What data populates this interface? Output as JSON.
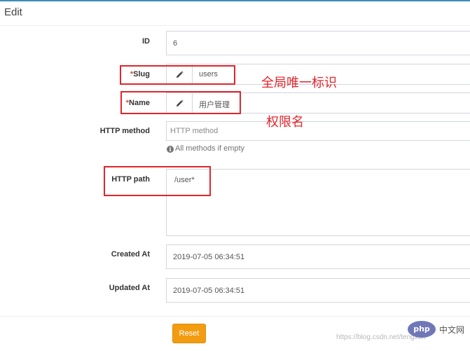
{
  "panel": {
    "title": "Edit"
  },
  "form": {
    "id": {
      "label": "ID",
      "value": "6"
    },
    "slug": {
      "required_mark": "*",
      "label": "Slug",
      "value": "users",
      "icon": "pencil-icon"
    },
    "name": {
      "required_mark": "*",
      "label": "Name",
      "value": "用户管理",
      "icon": "pencil-icon"
    },
    "http_method": {
      "label": "HTTP method",
      "placeholder": "HTTP method",
      "help": "All methods if empty",
      "help_icon": "info-circle-icon"
    },
    "http_path": {
      "label": "HTTP path",
      "value": "/user*"
    },
    "created_at": {
      "label": "Created At",
      "value": "2019-07-05 06:34:51"
    },
    "updated_at": {
      "label": "Updated At",
      "value": "2019-07-05 06:34:51"
    }
  },
  "annotations": {
    "slug_note": "全局唯一标识",
    "name_note": "权限名"
  },
  "footer": {
    "reset_label": "Reset",
    "watermark": "https://blog.csdn.net/tengxun",
    "php_logo": "php",
    "php_cn": "中文网"
  },
  "colors": {
    "accent": "#3c8dbc",
    "annotation_red": "#e0252b",
    "reset_button": "#f39c12",
    "required": "#dd4b39"
  }
}
